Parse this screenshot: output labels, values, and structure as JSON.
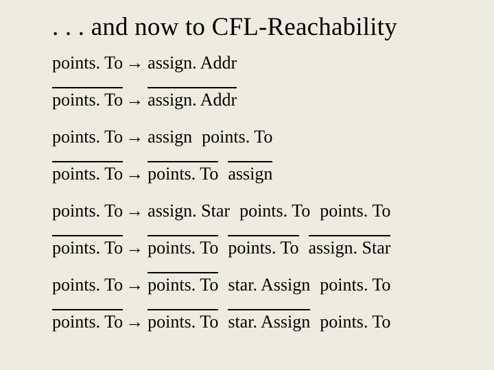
{
  "title": ". . . and now to CFL-Reachability",
  "arrow": "→",
  "rules": [
    {
      "lhs": {
        "text": "points. To",
        "bar": false
      },
      "rhs": [
        {
          "text": "assign. Addr",
          "bar": false
        }
      ]
    },
    {
      "lhs": {
        "text": "points. To",
        "bar": true
      },
      "rhs": [
        {
          "text": "assign. Addr",
          "bar": true
        }
      ]
    },
    {
      "lhs": {
        "text": "points. To",
        "bar": false
      },
      "rhs": [
        {
          "text": "assign",
          "bar": false
        },
        {
          "text": "points. To",
          "bar": false
        }
      ]
    },
    {
      "lhs": {
        "text": "points. To",
        "bar": true
      },
      "rhs": [
        {
          "text": "points. To",
          "bar": true
        },
        {
          "text": "assign",
          "bar": true
        }
      ]
    },
    {
      "lhs": {
        "text": "points. To",
        "bar": false
      },
      "rhs": [
        {
          "text": "assign. Star",
          "bar": false
        },
        {
          "text": "points. To",
          "bar": false
        },
        {
          "text": "points. To",
          "bar": false
        }
      ]
    },
    {
      "lhs": {
        "text": "points. To",
        "bar": true
      },
      "rhs": [
        {
          "text": "points. To",
          "bar": true
        },
        {
          "text": "points. To",
          "bar": true
        },
        {
          "text": "assign. Star",
          "bar": true
        }
      ]
    },
    {
      "lhs": {
        "text": "points. To",
        "bar": false
      },
      "rhs": [
        {
          "text": "points. To",
          "bar": true
        },
        {
          "text": "star. Assign",
          "bar": false
        },
        {
          "text": "points. To",
          "bar": false
        }
      ]
    },
    {
      "lhs": {
        "text": "points. To",
        "bar": true
      },
      "rhs": [
        {
          "text": "points. To",
          "bar": true
        },
        {
          "text": "star. Assign",
          "bar": true
        },
        {
          "text": "points. To",
          "bar": false
        }
      ]
    }
  ]
}
